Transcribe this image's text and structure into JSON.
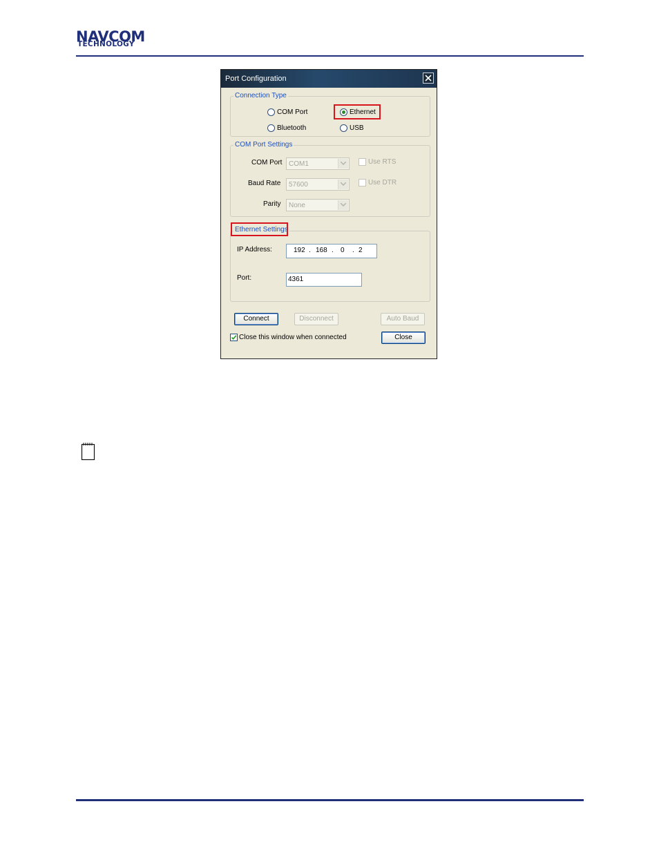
{
  "header": {
    "logo_top": "NAVCOM",
    "logo_bottom": "TECHNOLOGY"
  },
  "window": {
    "title": "Port Configuration"
  },
  "connection_type": {
    "legend": "Connection Type",
    "options": [
      {
        "label": "COM Port",
        "selected": false
      },
      {
        "label": "Ethernet",
        "selected": true
      },
      {
        "label": "Bluetooth",
        "selected": false
      },
      {
        "label": "USB",
        "selected": false
      }
    ]
  },
  "com_settings": {
    "legend": "COM Port Settings",
    "com_port_label": "COM Port",
    "com_port_value": "COM1",
    "baud_label": "Baud Rate",
    "baud_value": "57600",
    "parity_label": "Parity",
    "parity_value": "None",
    "use_rts_label": "Use RTS",
    "use_dtr_label": "Use DTR"
  },
  "ethernet_settings": {
    "legend": "Ethernet Settings",
    "ip_label": "IP Address:",
    "ip_octets": [
      "192",
      "168",
      "0",
      "2"
    ],
    "port_label": "Port:",
    "port_value": "4361"
  },
  "buttons": {
    "connect": "Connect",
    "disconnect": "Disconnect",
    "auto_baud": "Auto Baud",
    "close": "Close"
  },
  "close_when_connected": {
    "label": "Close this window when connected",
    "checked": true
  },
  "colors": {
    "brand": "#1f2f7a",
    "highlight": "#d8141c",
    "legend": "#1d4fbf"
  },
  "icons": {
    "note": "notepad-icon",
    "close": "close-icon"
  }
}
